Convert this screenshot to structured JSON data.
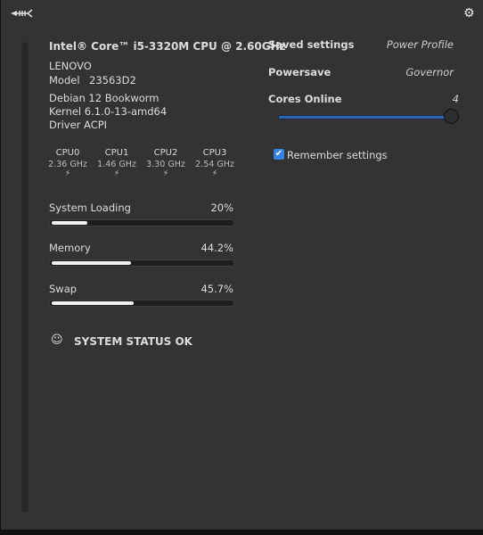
{
  "header": {
    "logo_icon": "fish-bone-icon",
    "settings_icon": "gear-icon"
  },
  "info": {
    "cpu_name": "Intel® Core™ i5-3320M CPU @ 2.60GHz",
    "vendor": "LENOVO",
    "model_label": "Model",
    "model_value": "23563D2",
    "os": "Debian 12 Bookworm",
    "kernel": "Kernel 6.1.0-13-amd64",
    "driver": "Driver ACPI"
  },
  "cpus": [
    {
      "name": "CPU0",
      "freq": "2.36",
      "unit": "GHz",
      "icon": "lightning-icon"
    },
    {
      "name": "CPU1",
      "freq": "1.46",
      "unit": "GHz",
      "icon": "lightning-icon"
    },
    {
      "name": "CPU2",
      "freq": "3.30",
      "unit": "GHz",
      "icon": "lightning-icon"
    },
    {
      "name": "CPU3",
      "freq": "2.54",
      "unit": "GHz",
      "icon": "lightning-icon"
    }
  ],
  "meters": [
    {
      "label": "System Loading",
      "value": "20%",
      "fraction": 0.2
    },
    {
      "label": "Memory",
      "value": "44.2%",
      "fraction": 0.442
    },
    {
      "label": "Swap",
      "value": "45.7%",
      "fraction": 0.457
    }
  ],
  "status": {
    "icon": "smiley-icon",
    "text": "SYSTEM STATUS OK"
  },
  "settings": {
    "saved_label": "Saved settings",
    "power_profile_label": "Power Profile",
    "powersave": "Powersave",
    "governor_label": "Governor",
    "cores_label": "Cores Online",
    "cores_value": "4",
    "cores_fraction": 1.0,
    "remember_label": "Remember settings",
    "remember_checked": true
  },
  "colors": {
    "background": "#333335",
    "accent": "#3584e4"
  }
}
